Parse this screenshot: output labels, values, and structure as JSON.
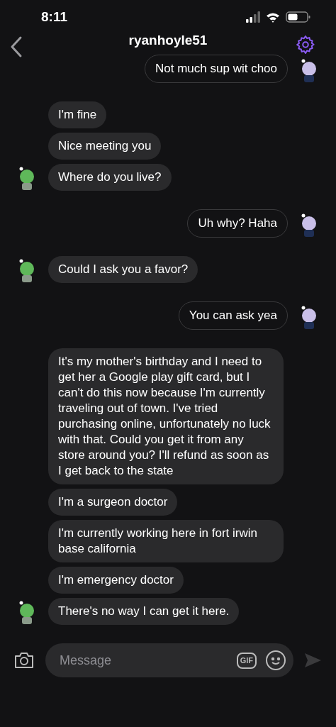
{
  "status_bar": {
    "time": "8:11"
  },
  "header": {
    "title": "ryanhoyle51"
  },
  "messages": [
    {
      "kind": "outgoing",
      "text": "Not much sup wit choo",
      "avatar": true
    },
    {
      "kind": "incoming",
      "text": "I'm fine",
      "avatar": false
    },
    {
      "kind": "incoming",
      "text": "Nice meeting you",
      "avatar": false
    },
    {
      "kind": "incoming",
      "text": "Where do you live?",
      "avatar": true
    },
    {
      "kind": "outgoing",
      "text": "Uh why? Haha",
      "avatar": true
    },
    {
      "kind": "incoming",
      "text": "Could I ask you a favor?",
      "avatar": true
    },
    {
      "kind": "outgoing",
      "text": "You can ask yea",
      "avatar": true
    },
    {
      "kind": "incoming",
      "text": "It's my mother's birthday and I need to get her a Google play gift card, but I can't do this now because I'm currently traveling out of town. I've tried purchasing online, unfortunately no luck with that. Could you get it from any store around you? I'll refund as soon as I get back to the state",
      "avatar": false
    },
    {
      "kind": "incoming",
      "text": "I'm a surgeon doctor",
      "avatar": false
    },
    {
      "kind": "incoming",
      "text": "I'm currently working here in fort irwin base california",
      "avatar": false
    },
    {
      "kind": "incoming",
      "text": "I'm emergency doctor",
      "avatar": false
    },
    {
      "kind": "incoming",
      "text": "There's no way I can get it here.",
      "avatar": true
    }
  ],
  "composer": {
    "placeholder": "Message",
    "gif_label": "GIF"
  }
}
